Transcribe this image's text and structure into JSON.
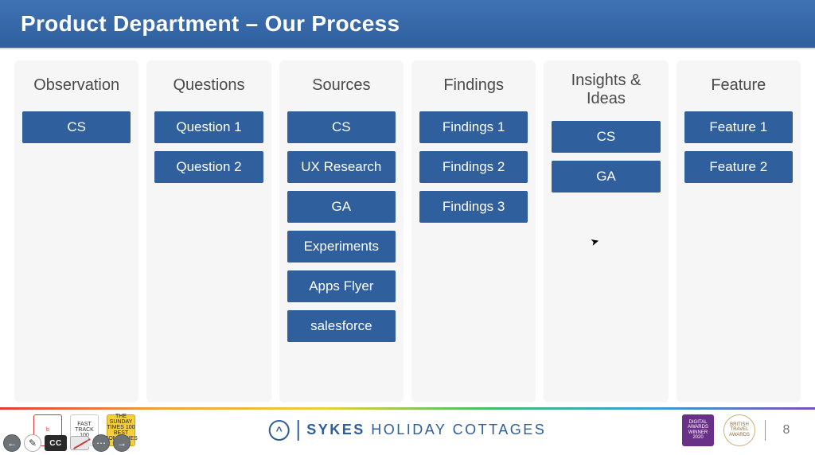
{
  "title": "Product Department – Our Process",
  "columns": [
    {
      "header": "Observation",
      "cards": [
        "CS"
      ]
    },
    {
      "header": "Questions",
      "cards": [
        "Question 1",
        "Question 2"
      ]
    },
    {
      "header": "Sources",
      "cards": [
        "CS",
        "UX Research",
        "GA",
        "Experiments",
        "Apps Flyer",
        "salesforce"
      ]
    },
    {
      "header": "Findings",
      "cards": [
        "Findings 1",
        "Findings 2",
        "Findings 3"
      ]
    },
    {
      "header": "Insights & Ideas",
      "cards": [
        "CS",
        "GA"
      ]
    },
    {
      "header": "Feature",
      "cards": [
        "Feature 1",
        "Feature 2"
      ]
    }
  ],
  "footer": {
    "brand_bold": "SYKES",
    "brand_rest": " HOLIDAY COTTAGES",
    "page_number": "8",
    "left_badges": [
      "b",
      "FAST TRACK 100",
      "THE SUNDAY TIMES 100 BEST COMPANIES 2019"
    ],
    "right_awards": [
      "DIGITAL AWARDS WINNER 2020",
      "BRITISH TRAVEL AWARDS"
    ]
  },
  "toolbar": {
    "prev": "←",
    "next": "→",
    "pencil": "✎",
    "cc": "CC",
    "more": "⋯"
  }
}
